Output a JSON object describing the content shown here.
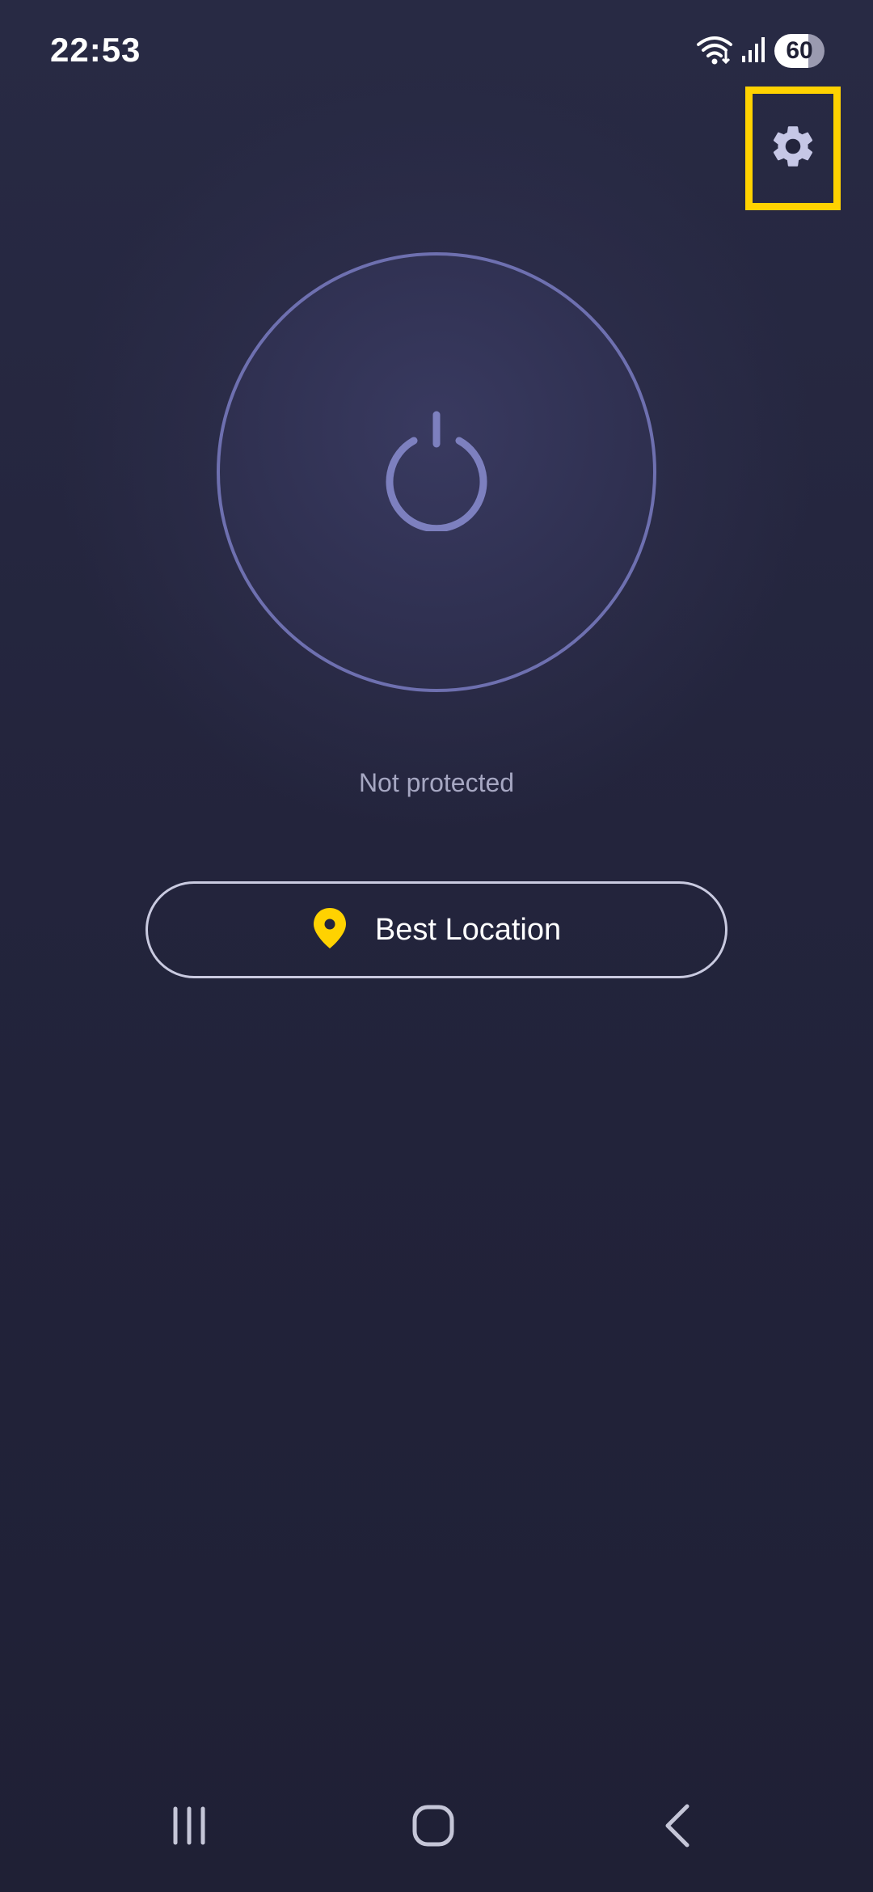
{
  "status_bar": {
    "time": "22:53",
    "battery_level": "60",
    "icons": [
      "wifi-icon",
      "signal-icon",
      "battery-icon"
    ]
  },
  "header": {
    "settings_icon": "gear-icon",
    "highlight_color": "#ffd200"
  },
  "main": {
    "power_icon": "power-icon",
    "connection_status": "Not protected",
    "location_button_label": "Best Location",
    "location_icon": "location-pin-icon",
    "accent_color": "#ffd200",
    "ring_color": "#6e70b0"
  },
  "navigation": {
    "buttons": [
      "recent-apps-icon",
      "home-icon",
      "back-icon"
    ]
  }
}
